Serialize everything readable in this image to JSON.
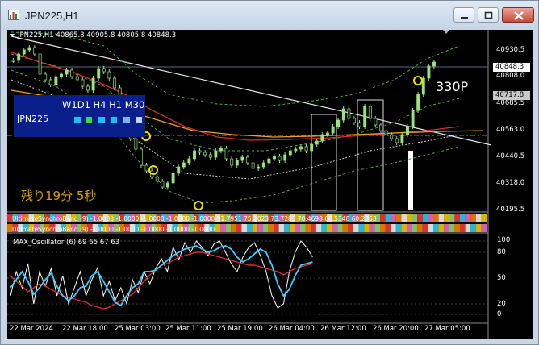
{
  "window": {
    "title": "JPN225,H1"
  },
  "chart": {
    "header": "JPN225,H1  40865.8 40905.8 40805.8 40848.3",
    "price_labels": [
      "40930.5",
      "40808.0",
      "40685.5",
      "40563.0",
      "40440.5",
      "40318.0",
      "40195.5"
    ],
    "tag_current": "40848.3",
    "tag_level": "40717.8",
    "x_labels": [
      "22 Mar 2024",
      "22 Mar 18:00",
      "25 Mar 03:00",
      "25 Mar 11:00",
      "25 Mar 19:00",
      "26 Mar 04:00",
      "26 Mar 12:00",
      "26 Mar 20:00",
      "27 Mar 05:00"
    ],
    "colors": {
      "background": "#000000",
      "candle": "#9be27d",
      "ma_red": "#e02a2a",
      "ma_orange": "#f0a020",
      "band_green": "#3bb54a",
      "trend_line": "#e6e6e6",
      "signal_circle": "#f0e000"
    }
  },
  "mtf_panel": {
    "timeframes": "W1D1 H4 H1 M30",
    "symbol": "JPN225",
    "squares": [
      "#19c3f0",
      "#35e035",
      "#19c3f0",
      "#19c3f0",
      "#7fb2e8",
      "#bcd8f5"
    ]
  },
  "annotations": {
    "countdown": "残り19分 5秒",
    "move": "330P"
  },
  "indicators": {
    "band1_label": "UltimateSynchroBand (9) -1.0000 -1.0000 -1.0000 -1.0000 -1.0000 91.7951 75.2023 73.7283 70.4698 68.5348 60.2853",
    "band2_label": "UltimateSynchroBand (9) -1.0000 -1.0000 -1.0000 -1.0000 -1.0000",
    "oscillator_label": "MAX_Oscillator (6) 69 65 67 63",
    "oscillator_levels": [
      "100",
      "80",
      "50",
      "20",
      "0"
    ]
  }
}
